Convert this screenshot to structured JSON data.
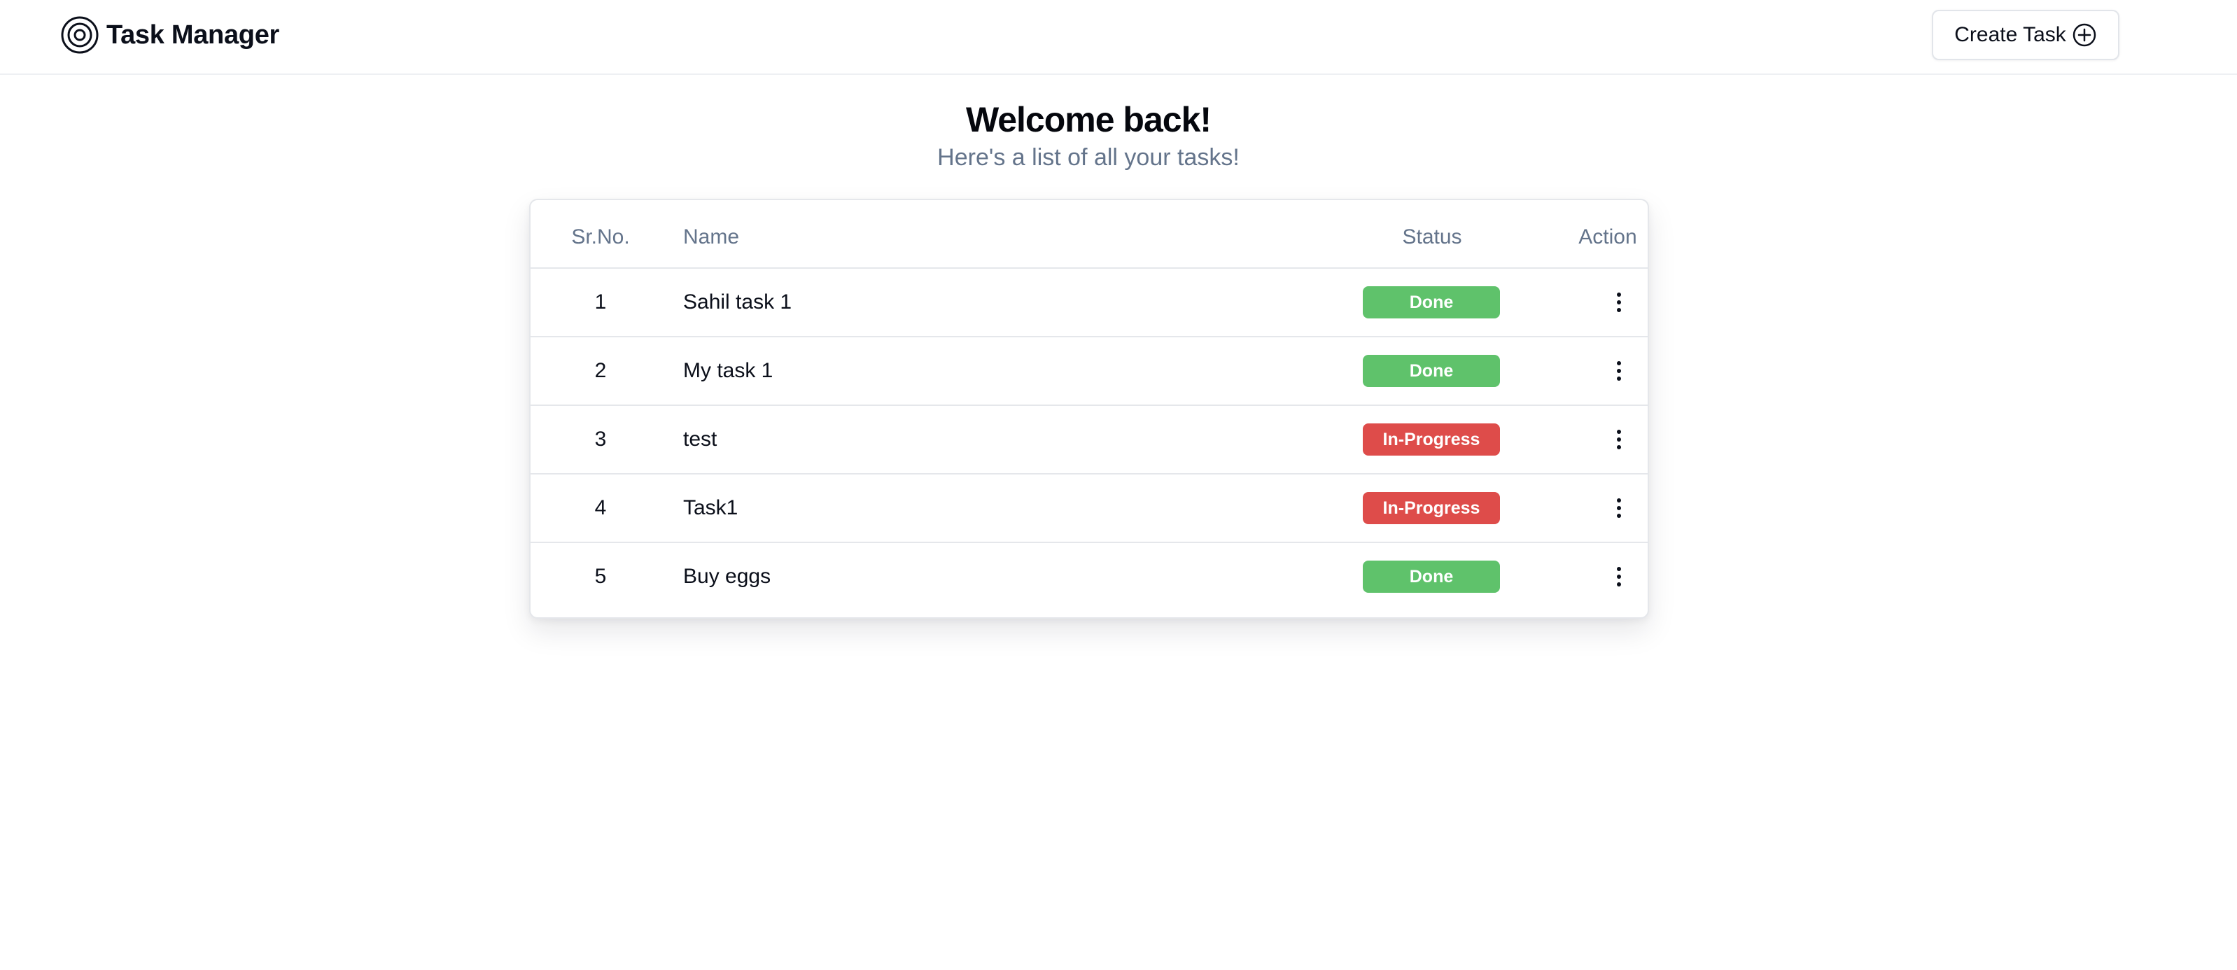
{
  "header": {
    "app_title": "Task Manager",
    "logo_icon": "target-icon",
    "create_button_label": "Create Task",
    "create_button_icon": "plus-circle-icon"
  },
  "hero": {
    "title": "Welcome back!",
    "subtitle": "Here's a list of all your tasks!"
  },
  "table": {
    "columns": {
      "srno": "Sr.No.",
      "name": "Name",
      "status": "Status",
      "action": "Action"
    },
    "rows": [
      {
        "srno": "1",
        "name": "Sahil task 1",
        "status": "Done"
      },
      {
        "srno": "2",
        "name": "My task 1",
        "status": "Done"
      },
      {
        "srno": "3",
        "name": "test",
        "status": "In-Progress"
      },
      {
        "srno": "4",
        "name": "Task1",
        "status": "In-Progress"
      },
      {
        "srno": "5",
        "name": "Buy eggs",
        "status": "Done"
      }
    ],
    "action_icon": "more-vertical-icon"
  },
  "colors": {
    "done": "#5fc26b",
    "in_progress": "#de4c4a",
    "muted_text": "#64748b",
    "border": "#e5e7eb"
  }
}
